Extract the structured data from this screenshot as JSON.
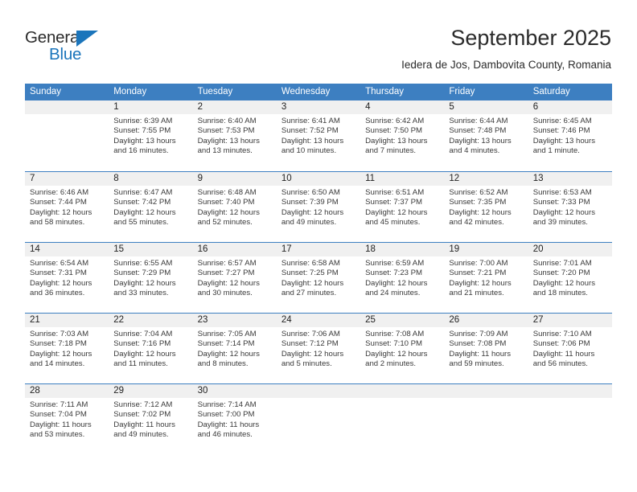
{
  "brand": {
    "name_part1": "General",
    "name_part2": "Blue",
    "triangle_color": "#1b75bb"
  },
  "header": {
    "title": "September 2025",
    "subtitle": "Iedera de Jos, Dambovita County, Romania"
  },
  "theme": {
    "header_blue": "#3d7fc1",
    "day_strip_gray": "#f0f0f0",
    "text_color": "#222222"
  },
  "weekdays": [
    "Sunday",
    "Monday",
    "Tuesday",
    "Wednesday",
    "Thursday",
    "Friday",
    "Saturday"
  ],
  "weeks": [
    [
      {
        "day": "",
        "sunrise": "",
        "sunset": "",
        "daylight_line1": "",
        "daylight_line2": ""
      },
      {
        "day": "1",
        "sunrise": "Sunrise: 6:39 AM",
        "sunset": "Sunset: 7:55 PM",
        "daylight_line1": "Daylight: 13 hours",
        "daylight_line2": "and 16 minutes."
      },
      {
        "day": "2",
        "sunrise": "Sunrise: 6:40 AM",
        "sunset": "Sunset: 7:53 PM",
        "daylight_line1": "Daylight: 13 hours",
        "daylight_line2": "and 13 minutes."
      },
      {
        "day": "3",
        "sunrise": "Sunrise: 6:41 AM",
        "sunset": "Sunset: 7:52 PM",
        "daylight_line1": "Daylight: 13 hours",
        "daylight_line2": "and 10 minutes."
      },
      {
        "day": "4",
        "sunrise": "Sunrise: 6:42 AM",
        "sunset": "Sunset: 7:50 PM",
        "daylight_line1": "Daylight: 13 hours",
        "daylight_line2": "and 7 minutes."
      },
      {
        "day": "5",
        "sunrise": "Sunrise: 6:44 AM",
        "sunset": "Sunset: 7:48 PM",
        "daylight_line1": "Daylight: 13 hours",
        "daylight_line2": "and 4 minutes."
      },
      {
        "day": "6",
        "sunrise": "Sunrise: 6:45 AM",
        "sunset": "Sunset: 7:46 PM",
        "daylight_line1": "Daylight: 13 hours",
        "daylight_line2": "and 1 minute."
      }
    ],
    [
      {
        "day": "7",
        "sunrise": "Sunrise: 6:46 AM",
        "sunset": "Sunset: 7:44 PM",
        "daylight_line1": "Daylight: 12 hours",
        "daylight_line2": "and 58 minutes."
      },
      {
        "day": "8",
        "sunrise": "Sunrise: 6:47 AM",
        "sunset": "Sunset: 7:42 PM",
        "daylight_line1": "Daylight: 12 hours",
        "daylight_line2": "and 55 minutes."
      },
      {
        "day": "9",
        "sunrise": "Sunrise: 6:48 AM",
        "sunset": "Sunset: 7:40 PM",
        "daylight_line1": "Daylight: 12 hours",
        "daylight_line2": "and 52 minutes."
      },
      {
        "day": "10",
        "sunrise": "Sunrise: 6:50 AM",
        "sunset": "Sunset: 7:39 PM",
        "daylight_line1": "Daylight: 12 hours",
        "daylight_line2": "and 49 minutes."
      },
      {
        "day": "11",
        "sunrise": "Sunrise: 6:51 AM",
        "sunset": "Sunset: 7:37 PM",
        "daylight_line1": "Daylight: 12 hours",
        "daylight_line2": "and 45 minutes."
      },
      {
        "day": "12",
        "sunrise": "Sunrise: 6:52 AM",
        "sunset": "Sunset: 7:35 PM",
        "daylight_line1": "Daylight: 12 hours",
        "daylight_line2": "and 42 minutes."
      },
      {
        "day": "13",
        "sunrise": "Sunrise: 6:53 AM",
        "sunset": "Sunset: 7:33 PM",
        "daylight_line1": "Daylight: 12 hours",
        "daylight_line2": "and 39 minutes."
      }
    ],
    [
      {
        "day": "14",
        "sunrise": "Sunrise: 6:54 AM",
        "sunset": "Sunset: 7:31 PM",
        "daylight_line1": "Daylight: 12 hours",
        "daylight_line2": "and 36 minutes."
      },
      {
        "day": "15",
        "sunrise": "Sunrise: 6:55 AM",
        "sunset": "Sunset: 7:29 PM",
        "daylight_line1": "Daylight: 12 hours",
        "daylight_line2": "and 33 minutes."
      },
      {
        "day": "16",
        "sunrise": "Sunrise: 6:57 AM",
        "sunset": "Sunset: 7:27 PM",
        "daylight_line1": "Daylight: 12 hours",
        "daylight_line2": "and 30 minutes."
      },
      {
        "day": "17",
        "sunrise": "Sunrise: 6:58 AM",
        "sunset": "Sunset: 7:25 PM",
        "daylight_line1": "Daylight: 12 hours",
        "daylight_line2": "and 27 minutes."
      },
      {
        "day": "18",
        "sunrise": "Sunrise: 6:59 AM",
        "sunset": "Sunset: 7:23 PM",
        "daylight_line1": "Daylight: 12 hours",
        "daylight_line2": "and 24 minutes."
      },
      {
        "day": "19",
        "sunrise": "Sunrise: 7:00 AM",
        "sunset": "Sunset: 7:21 PM",
        "daylight_line1": "Daylight: 12 hours",
        "daylight_line2": "and 21 minutes."
      },
      {
        "day": "20",
        "sunrise": "Sunrise: 7:01 AM",
        "sunset": "Sunset: 7:20 PM",
        "daylight_line1": "Daylight: 12 hours",
        "daylight_line2": "and 18 minutes."
      }
    ],
    [
      {
        "day": "21",
        "sunrise": "Sunrise: 7:03 AM",
        "sunset": "Sunset: 7:18 PM",
        "daylight_line1": "Daylight: 12 hours",
        "daylight_line2": "and 14 minutes."
      },
      {
        "day": "22",
        "sunrise": "Sunrise: 7:04 AM",
        "sunset": "Sunset: 7:16 PM",
        "daylight_line1": "Daylight: 12 hours",
        "daylight_line2": "and 11 minutes."
      },
      {
        "day": "23",
        "sunrise": "Sunrise: 7:05 AM",
        "sunset": "Sunset: 7:14 PM",
        "daylight_line1": "Daylight: 12 hours",
        "daylight_line2": "and 8 minutes."
      },
      {
        "day": "24",
        "sunrise": "Sunrise: 7:06 AM",
        "sunset": "Sunset: 7:12 PM",
        "daylight_line1": "Daylight: 12 hours",
        "daylight_line2": "and 5 minutes."
      },
      {
        "day": "25",
        "sunrise": "Sunrise: 7:08 AM",
        "sunset": "Sunset: 7:10 PM",
        "daylight_line1": "Daylight: 12 hours",
        "daylight_line2": "and 2 minutes."
      },
      {
        "day": "26",
        "sunrise": "Sunrise: 7:09 AM",
        "sunset": "Sunset: 7:08 PM",
        "daylight_line1": "Daylight: 11 hours",
        "daylight_line2": "and 59 minutes."
      },
      {
        "day": "27",
        "sunrise": "Sunrise: 7:10 AM",
        "sunset": "Sunset: 7:06 PM",
        "daylight_line1": "Daylight: 11 hours",
        "daylight_line2": "and 56 minutes."
      }
    ],
    [
      {
        "day": "28",
        "sunrise": "Sunrise: 7:11 AM",
        "sunset": "Sunset: 7:04 PM",
        "daylight_line1": "Daylight: 11 hours",
        "daylight_line2": "and 53 minutes."
      },
      {
        "day": "29",
        "sunrise": "Sunrise: 7:12 AM",
        "sunset": "Sunset: 7:02 PM",
        "daylight_line1": "Daylight: 11 hours",
        "daylight_line2": "and 49 minutes."
      },
      {
        "day": "30",
        "sunrise": "Sunrise: 7:14 AM",
        "sunset": "Sunset: 7:00 PM",
        "daylight_line1": "Daylight: 11 hours",
        "daylight_line2": "and 46 minutes."
      },
      {
        "day": "",
        "sunrise": "",
        "sunset": "",
        "daylight_line1": "",
        "daylight_line2": ""
      },
      {
        "day": "",
        "sunrise": "",
        "sunset": "",
        "daylight_line1": "",
        "daylight_line2": ""
      },
      {
        "day": "",
        "sunrise": "",
        "sunset": "",
        "daylight_line1": "",
        "daylight_line2": ""
      },
      {
        "day": "",
        "sunrise": "",
        "sunset": "",
        "daylight_line1": "",
        "daylight_line2": ""
      }
    ]
  ]
}
